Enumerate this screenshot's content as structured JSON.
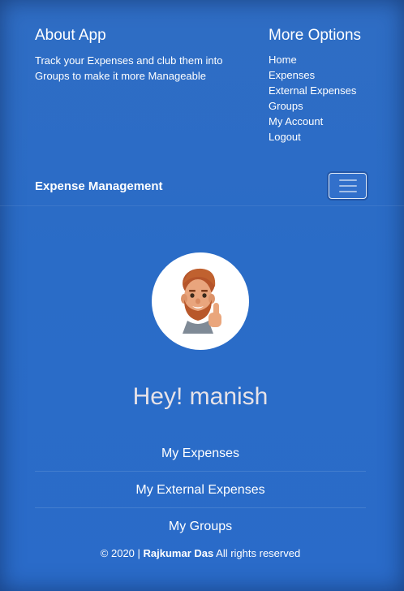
{
  "about": {
    "title": "About App",
    "description": "Track your Expenses and club them into Groups to make it more Manageable"
  },
  "more_options": {
    "title": "More Options",
    "links": [
      "Home",
      "Expenses",
      "External Expenses",
      "Groups",
      "My Account",
      "Logout"
    ]
  },
  "navbar": {
    "brand": "Expense Management",
    "toggler_icon": "hamburger-icon"
  },
  "profile": {
    "avatar_icon": "memoji-avatar-icon",
    "greeting": "Hey! manish"
  },
  "menu": {
    "items": [
      "My Expenses",
      "My External Expenses",
      "My Groups"
    ]
  },
  "footer": {
    "prefix": "© 2020 |",
    "author": "Rajkumar Das",
    "suffix": "All rights reserved"
  },
  "colors": {
    "background": "#2a6cc7",
    "text": "#ffffff",
    "greeting": "#e6e2e8"
  }
}
